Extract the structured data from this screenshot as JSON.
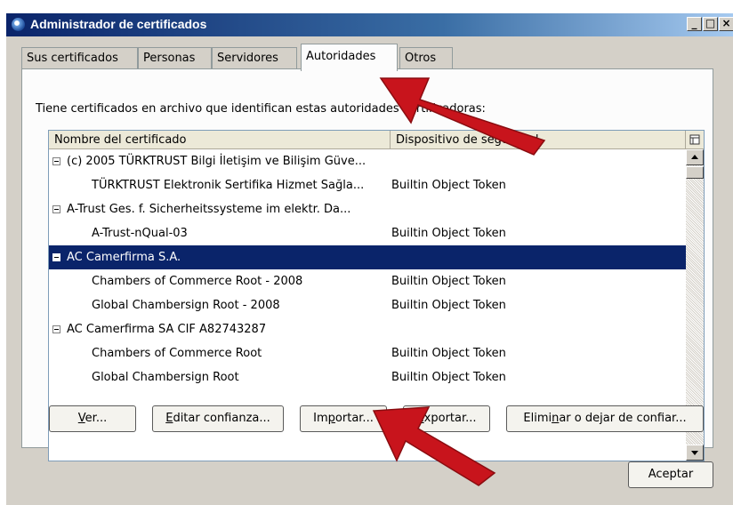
{
  "window": {
    "title": "Administrador de certificados",
    "min_label": "_",
    "max_label": "□",
    "close_label": "×"
  },
  "tabs": [
    {
      "label": "Sus certificados",
      "active": false
    },
    {
      "label": "Personas",
      "active": false
    },
    {
      "label": "Servidores",
      "active": false
    },
    {
      "label": "Autoridades",
      "active": true
    },
    {
      "label": "Otros",
      "active": false
    }
  ],
  "panel": {
    "description": "Tiene certificados en archivo que identifican estas autoridades certificadoras:"
  },
  "table": {
    "columns": [
      "Nombre del certificado",
      "Dispositivo de seguridad"
    ],
    "rows": [
      {
        "name": "(c) 2005 TÜRKTRUST Bilgi İletişim ve Bilişim Güve...",
        "device": "",
        "group": true,
        "selected": false
      },
      {
        "name": "TÜRKTRUST Elektronik Sertifika Hizmet Sağla...",
        "device": "Builtin Object Token",
        "group": false,
        "selected": false
      },
      {
        "name": "A-Trust Ges. f. Sicherheitssysteme im elektr. Da...",
        "device": "",
        "group": true,
        "selected": false
      },
      {
        "name": "A-Trust-nQual-03",
        "device": "Builtin Object Token",
        "group": false,
        "selected": false
      },
      {
        "name": "AC Camerfirma S.A.",
        "device": "",
        "group": true,
        "selected": true
      },
      {
        "name": "Chambers of Commerce Root - 2008",
        "device": "Builtin Object Token",
        "group": false,
        "selected": false
      },
      {
        "name": "Global Chambersign Root - 2008",
        "device": "Builtin Object Token",
        "group": false,
        "selected": false
      },
      {
        "name": "AC Camerfirma SA CIF A82743287",
        "device": "",
        "group": true,
        "selected": false
      },
      {
        "name": "Chambers of Commerce Root",
        "device": "Builtin Object Token",
        "group": false,
        "selected": false
      },
      {
        "name": "Global Chambersign Root",
        "device": "Builtin Object Token",
        "group": false,
        "selected": false
      }
    ]
  },
  "buttons": {
    "ver": {
      "pre": "",
      "key": "V",
      "post": "er..."
    },
    "editar": {
      "pre": "",
      "key": "E",
      "post": "ditar confianza..."
    },
    "importar": {
      "pre": "Im",
      "key": "p",
      "post": "ortar..."
    },
    "exportar": {
      "pre": "",
      "key": "E",
      "post": "xportar..."
    },
    "eliminar": {
      "pre": "Elimi",
      "key": "n",
      "post": "ar o dejar de confiar..."
    },
    "aceptar": "Aceptar"
  },
  "icons": {
    "app": "certificate-manager-icon",
    "column_picker": "column-picker-icon",
    "annotation_color": "#c8141c"
  }
}
